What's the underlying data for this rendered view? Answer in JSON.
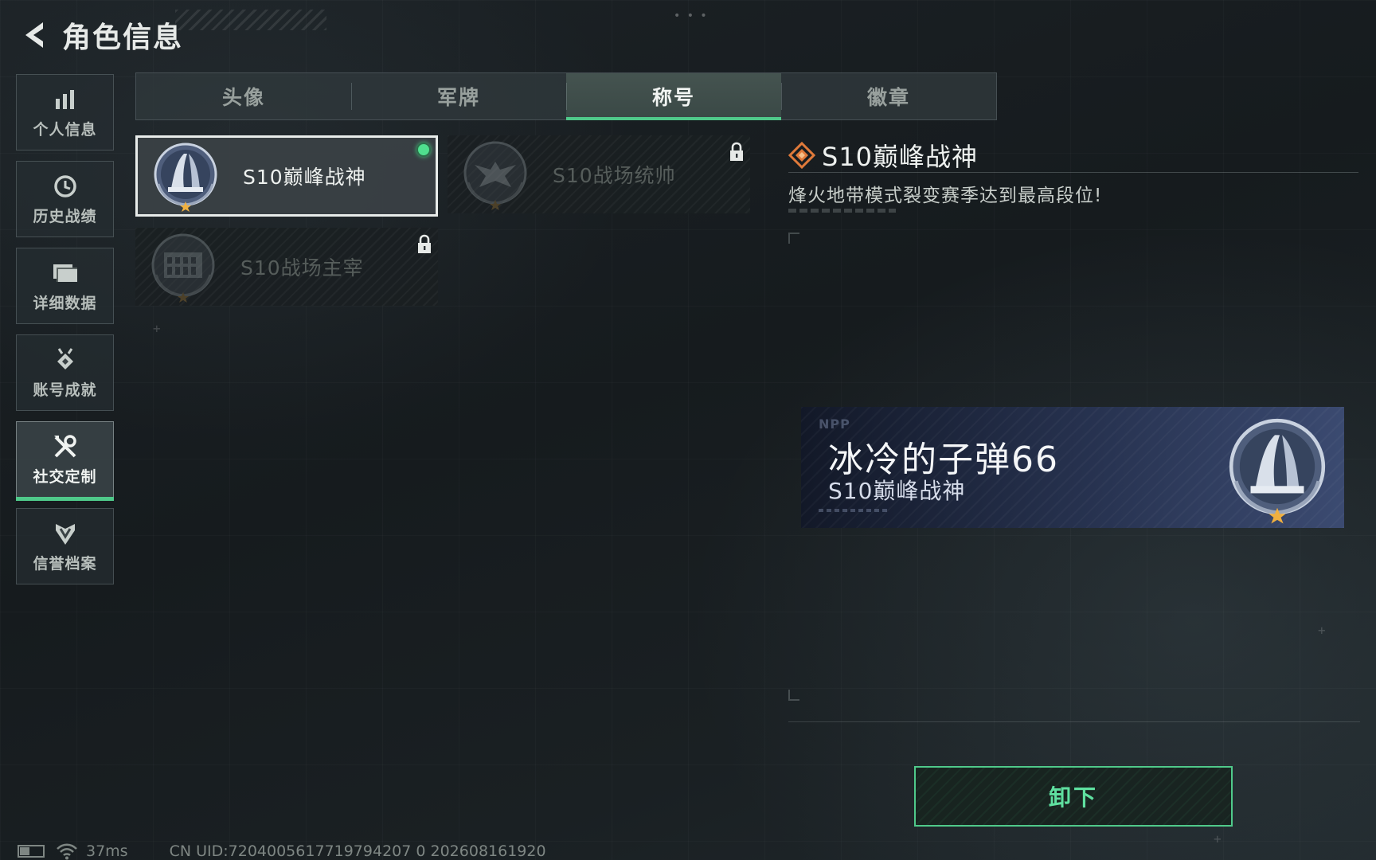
{
  "header": {
    "title": "角色信息"
  },
  "sidebar": {
    "items": [
      {
        "label": "个人信息",
        "icon": "bar-chart-icon"
      },
      {
        "label": "历史战绩",
        "icon": "clock-icon"
      },
      {
        "label": "详细数据",
        "icon": "folder-icon"
      },
      {
        "label": "账号成就",
        "icon": "medal-icon"
      },
      {
        "label": "社交定制",
        "icon": "tools-icon",
        "active": true
      },
      {
        "label": "信誉档案",
        "icon": "shield-chevron-icon"
      }
    ]
  },
  "tabs": [
    {
      "label": "头像"
    },
    {
      "label": "军牌"
    },
    {
      "label": "称号",
      "active": true
    },
    {
      "label": "徽章"
    }
  ],
  "titles": [
    {
      "name": "S10巅峰战神",
      "state": "selected",
      "equipped": true
    },
    {
      "name": "S10战场统帅",
      "state": "locked"
    },
    {
      "name": "S10战场主宰",
      "state": "locked"
    }
  ],
  "detail": {
    "title": "S10巅峰战神",
    "description": "烽火地带模式裂变赛季达到最高段位!"
  },
  "nameplate": {
    "mark": "NPP",
    "player_name": "冰冷的子弹66",
    "title": "S10巅峰战神"
  },
  "actions": {
    "unequip_label": "卸下"
  },
  "status": {
    "ping": "37ms",
    "uid_text": "CN UID:7204005617719794207 0 202608161920"
  },
  "colors": {
    "accent": "#4fc98a",
    "equipped_dot": "#4fe08e",
    "detail_icon": "#e07a3a"
  }
}
